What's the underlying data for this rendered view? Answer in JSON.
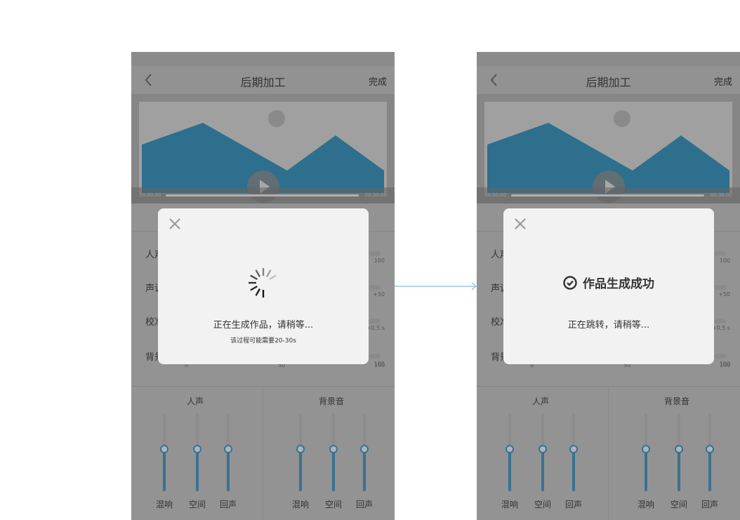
{
  "screens": [
    {
      "nav": {
        "title": "后期加工",
        "done": "完成"
      },
      "video": {
        "time_start": "00:00:00",
        "time_end": "00:30:00"
      },
      "rows": [
        {
          "label": "人声",
          "value": "100"
        },
        {
          "label": "声调",
          "value": "+50"
        },
        {
          "label": "校准",
          "value": "+0.5 s"
        },
        {
          "label": "背景",
          "value": "100"
        }
      ],
      "scale": [
        "0",
        "50",
        "100"
      ],
      "panels": [
        {
          "title": "人声",
          "sliders": [
            {
              "label": "混响",
              "value": 0.54
            },
            {
              "label": "空间",
              "value": 0.54
            },
            {
              "label": "回声",
              "value": 0.54
            }
          ]
        },
        {
          "title": "背景音",
          "sliders": [
            {
              "label": "混响",
              "value": 0.54
            },
            {
              "label": "空间",
              "value": 0.54
            },
            {
              "label": "回声",
              "value": 0.54
            }
          ]
        }
      ],
      "modal": {
        "type": "loading",
        "message": "正在生成作品，请稍等...",
        "sub": "该过程可能需要20-30s"
      }
    },
    {
      "nav": {
        "title": "后期加工",
        "done": "完成"
      },
      "video": {
        "time_start": "00:00:00",
        "time_end": "00:30:00"
      },
      "rows": [
        {
          "label": "人声",
          "value": "100"
        },
        {
          "label": "声调",
          "value": "+50"
        },
        {
          "label": "校准",
          "value": "+0.5 s"
        },
        {
          "label": "背景",
          "value": "100"
        }
      ],
      "scale": [
        "0",
        "50",
        "100"
      ],
      "panels": [
        {
          "title": "人声",
          "sliders": [
            {
              "label": "混响",
              "value": 0.54
            },
            {
              "label": "空间",
              "value": 0.54
            },
            {
              "label": "回声",
              "value": 0.54
            }
          ]
        },
        {
          "title": "背景音",
          "sliders": [
            {
              "label": "混响",
              "value": 0.54
            },
            {
              "label": "空间",
              "value": 0.54
            },
            {
              "label": "回声",
              "value": 0.54
            }
          ]
        }
      ],
      "modal": {
        "type": "success",
        "title": "作品生成成功",
        "message": "正在跳转，请稍等..."
      }
    }
  ],
  "colors": {
    "accent": "#3a7190",
    "mountain": "#2e6f8e",
    "arrow": "#7fc0dc"
  }
}
